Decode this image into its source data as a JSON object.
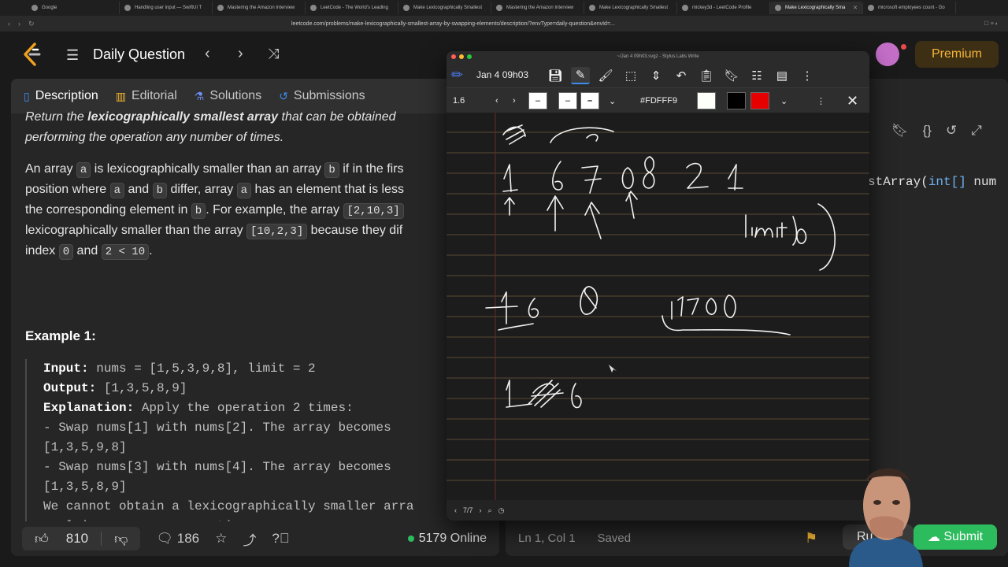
{
  "browser": {
    "tabs": [
      {
        "label": "Google"
      },
      {
        "label": "Handling user input — SwiftUI T"
      },
      {
        "label": "Mastering the Amazon Interview"
      },
      {
        "label": "LeetCode - The World's Leading"
      },
      {
        "label": "Make Lexicographically Smallest"
      },
      {
        "label": "Mastering the Amazon Interview"
      },
      {
        "label": "Make Lexicographically Smallest"
      },
      {
        "label": "mickey3d - LeetCode Profile"
      },
      {
        "label": "Make Lexicographically Sma"
      },
      {
        "label": "microsoft employees count - Go"
      }
    ],
    "url": "leetcode.com/problems/make-lexicographically-smallest-array-by-swapping-elements/description/?envType=daily-question&envId=..."
  },
  "header": {
    "title": "Daily Question",
    "premium_label": "Premium"
  },
  "panel_tabs": {
    "description": "Description",
    "editorial": "Editorial",
    "solutions": "Solutions",
    "submissions": "Submissions"
  },
  "problem": {
    "line1a": "Return the ",
    "line1b": "lexicographically smallest array",
    "line1c": " that can be obtained",
    "line2": "performing the operation any number of times.",
    "p2_1a": "An array ",
    "p2_1b": "a",
    "p2_1c": " is lexicographically smaller than an array ",
    "p2_1d": "b",
    "p2_1e": " if in the firs",
    "p2_2a": "position where ",
    "p2_2b": "a",
    "p2_2c": " and ",
    "p2_2d": "b",
    "p2_2e": " differ, array ",
    "p2_2f": "a",
    "p2_2g": " has an element that is less",
    "p2_3a": "the corresponding element in ",
    "p2_3b": "b",
    "p2_3c": ". For example, the array ",
    "p2_3d": "[2,10,3]",
    "p2_4a": "lexicographically smaller than the array ",
    "p2_4b": "[10,2,3]",
    "p2_4c": " because they dif",
    "p2_5a": "index ",
    "p2_5b": "0",
    "p2_5c": " and ",
    "p2_5d": "2 < 10",
    "p2_5e": ".",
    "example_title": "Example 1:",
    "ex_input_label": "Input:",
    "ex_input": " nums = [1,5,3,9,8], limit = 2",
    "ex_output_label": "Output:",
    "ex_output": " [1,3,5,8,9]",
    "ex_expl_label": "Explanation:",
    "ex_expl": " Apply the operation 2 times:",
    "ex_l4": "- Swap nums[1] with nums[2]. The array becomes",
    "ex_l5": "[1,3,5,9,8]",
    "ex_l6": "- Swap nums[3] with nums[4]. The array becomes",
    "ex_l7": "[1,3,5,8,9]",
    "ex_l8": "We cannot obtain a lexicographically smaller arra",
    "ex_l9": "applying any more operations."
  },
  "footer": {
    "likes": "810",
    "comments": "186",
    "online": "5179 Online"
  },
  "editor": {
    "code_prefix": "stArray(",
    "code_type": "int[]",
    "code_suffix": " num",
    "cursor": "Ln 1, Col 1",
    "status": "Saved",
    "run_label": "Ru",
    "submit_label": "Submit"
  },
  "stylus": {
    "window_title": "~/Jan  4 09h03.svgz - Stylus Labs Write",
    "doc_name": "Jan  4 09h03",
    "pen_width": "1.6",
    "color_hex": "#FDFFF9",
    "page_indicator": "7/7"
  },
  "colors": {
    "accent_green": "#2cbb5d",
    "premium_gold": "#f5b437",
    "swatch_white": "#FDFFF9",
    "swatch_black": "#000000",
    "swatch_red": "#e60000"
  }
}
